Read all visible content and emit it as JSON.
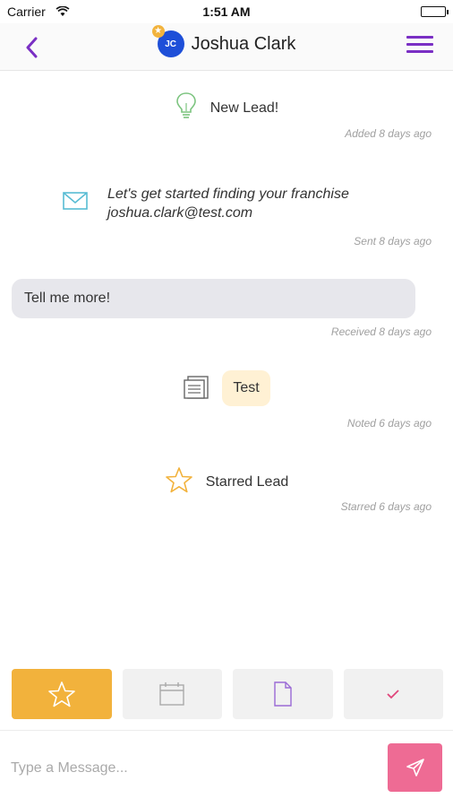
{
  "status_bar": {
    "carrier": "Carrier",
    "time": "1:51 AM"
  },
  "header": {
    "title": "Joshua Clark",
    "avatar_initials": "JC"
  },
  "timeline": {
    "events": [
      {
        "type": "lead",
        "icon": "lightbulb-icon",
        "text": "New Lead!",
        "meta": "Added 8 days ago"
      },
      {
        "type": "email",
        "icon": "envelope-icon",
        "subject": "Let's get started finding your franchise",
        "address": "joshua.clark@test.com",
        "meta": "Sent 8 days ago"
      },
      {
        "type": "received",
        "text": "Tell me more!",
        "meta": "Received 8 days ago"
      },
      {
        "type": "note",
        "icon": "document-icon",
        "text": "Test",
        "meta": "Noted 6 days ago"
      },
      {
        "type": "star",
        "icon": "star-icon",
        "text": "Starred Lead",
        "meta": "Starred 6 days ago"
      }
    ]
  },
  "actions": [
    {
      "name": "star",
      "icon": "star-icon",
      "active": true
    },
    {
      "name": "calendar",
      "icon": "calendar-icon",
      "active": false
    },
    {
      "name": "note",
      "icon": "document-icon",
      "active": false
    },
    {
      "name": "task",
      "icon": "checkmark-icon",
      "active": false
    }
  ],
  "composer": {
    "placeholder": "Type a Message..."
  },
  "colors": {
    "accent": "#7a2fc4",
    "star_active": "#f2b23c",
    "send": "#ee6b94",
    "bubble": "#e7e7ec",
    "note": "#fff1d4"
  }
}
